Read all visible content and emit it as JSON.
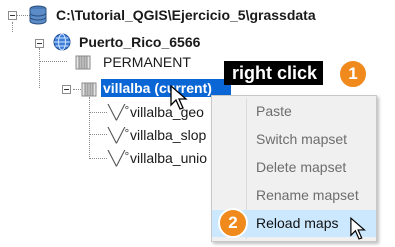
{
  "tree": {
    "root_label": "C:\\Tutorial_QGIS\\Ejercicio_5\\grassdata",
    "location_label": "Puerto_Rico_6566",
    "mapsets": [
      {
        "label": "PERMANENT"
      },
      {
        "label": "villalba (current)"
      }
    ],
    "maps": [
      {
        "label": "villalba_geo"
      },
      {
        "label": "villalba_slop"
      },
      {
        "label": "villalba_unio"
      }
    ]
  },
  "callouts": {
    "step1_text": "right click",
    "step1_number": "1",
    "step2_number": "2"
  },
  "context_menu": {
    "items": [
      {
        "label": "Paste",
        "enabled": false
      },
      {
        "label": "Switch mapset",
        "enabled": false
      },
      {
        "label": "Delete mapset",
        "enabled": false
      },
      {
        "label": "Rename mapset",
        "enabled": false
      },
      {
        "label": "Reload maps",
        "enabled": true,
        "highlighted": true
      }
    ]
  },
  "colors": {
    "selection": "#0a66d4",
    "badge": "#f08a1c",
    "menu_highlight": "#cce8ff"
  }
}
